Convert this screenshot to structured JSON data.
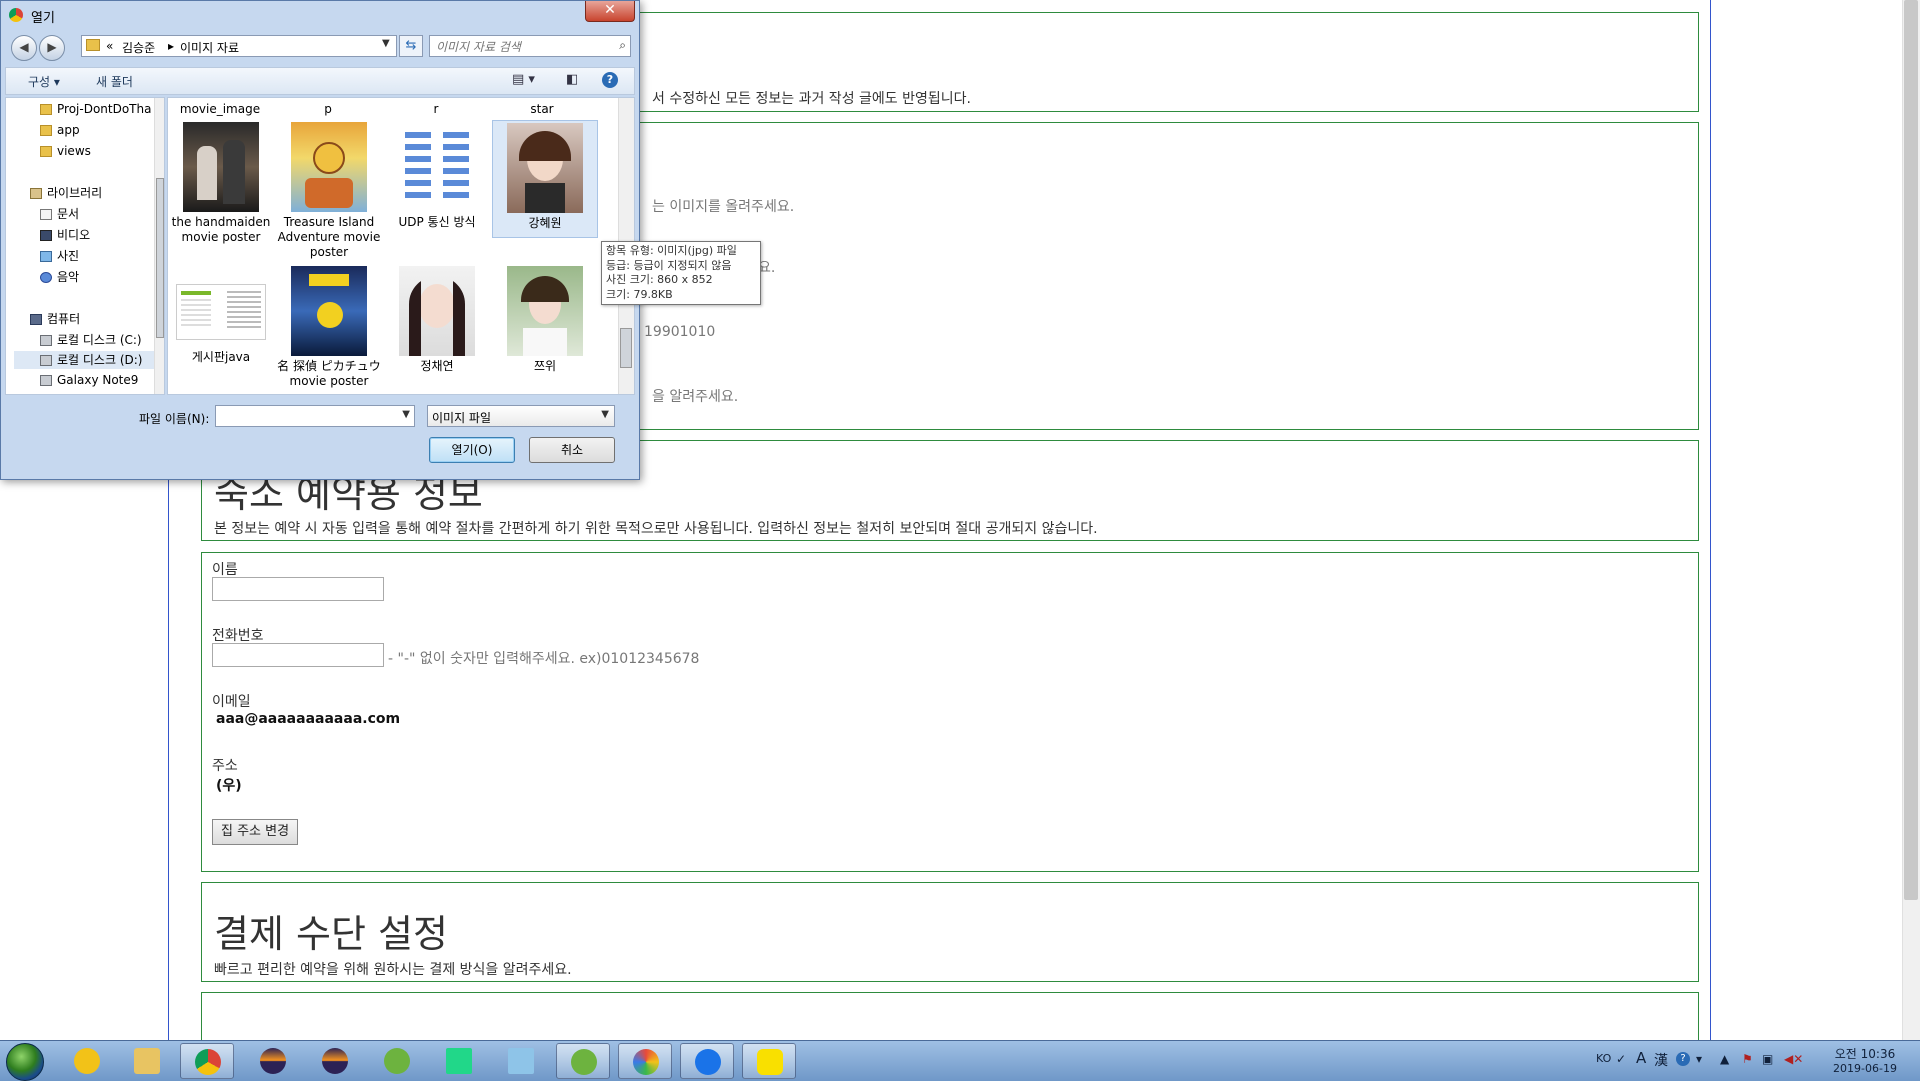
{
  "page": {
    "box1_desc": "서 수정하신 모든 정보는 과거 작성 글에도 반영됩니다.",
    "box2": {
      "hint1": "는 이미지를 올려주세요.",
      "hint2": "요.",
      "hint3": "19901010",
      "hint4": "을 알려주세요."
    },
    "lodging": {
      "title": "숙소 예약용 정보",
      "desc": "본 정보는 예약 시 자동 입력을 통해 예약 절차를 간편하게 하기 위한 목적으로만 사용됩니다. 입력하신 정보는 철저히 보안되며 절대 공개되지 않습니다."
    },
    "form": {
      "name_label": "이름",
      "phone_label": "전화번호",
      "phone_hint": "- \"-\" 없이 숫자만 입력해주세요. ex)01012345678",
      "email_label": "이메일",
      "email_value": "aaa@aaaaaaaaaaa.com",
      "address_label": "주소",
      "address_value": "(우)",
      "change_address_button": "집 주소 변경"
    },
    "payment": {
      "title": "결제 수단 설정",
      "desc": "빠르고 편리한 예약을 위해 원하시는 결제 방식을 알려주세요."
    }
  },
  "dialog": {
    "title": "열기",
    "close_label": "✕",
    "breadcrumb": [
      "«",
      "김승준",
      "▸",
      "이미지 자료"
    ],
    "search_placeholder": "이미지 자료 검색",
    "toolbar": {
      "organize": "구성 ▾",
      "new_folder": "새 폴더",
      "help": "?"
    },
    "nav_items": [
      {
        "label": "Proj-DontDoTha",
        "icon": "folder-icon"
      },
      {
        "label": "app",
        "icon": "folder-icon"
      },
      {
        "label": "views",
        "icon": "folder-icon"
      },
      {
        "label": "라이브러리",
        "icon": "library-icon"
      },
      {
        "label": "문서",
        "icon": "documents-icon"
      },
      {
        "label": "비디오",
        "icon": "video-icon"
      },
      {
        "label": "사진",
        "icon": "pictures-icon"
      },
      {
        "label": "음악",
        "icon": "music-icon"
      },
      {
        "label": "컴퓨터",
        "icon": "computer-icon"
      },
      {
        "label": "로컬 디스크 (C:)",
        "icon": "disk-icon"
      },
      {
        "label": "로컬 디스크 (D:)",
        "icon": "disk-icon"
      },
      {
        "label": "Galaxy Note9",
        "icon": "phone-icon"
      }
    ],
    "column_labels": [
      "movie_image",
      "p",
      "r",
      "star"
    ],
    "files": [
      {
        "label": "the handmaiden movie poster"
      },
      {
        "label": "Treasure Island Adventure movie poster"
      },
      {
        "label": "UDP 통신 방식"
      },
      {
        "label": "강혜원"
      },
      {
        "label": "게시판java"
      },
      {
        "label": "名 探偵 ピカチュウ movie poster"
      },
      {
        "label": "정채연"
      },
      {
        "label": "쯔위"
      }
    ],
    "tooltip": {
      "line1": "항목 유형: 이미지(jpg) 파일",
      "line2": "등급: 등급이 지정되지 않음",
      "line3": "사진 크기: 860 x 852",
      "line4": "크기: 79.8KB"
    },
    "filename_label": "파일 이름(N):",
    "filename_value": "",
    "filetype_value": "이미지 파일",
    "open_button": "열기(O)",
    "cancel_button": "취소"
  },
  "taskbar": {
    "apps": [
      "media-player",
      "file-explorer",
      "chrome",
      "eclipse",
      "eclipse-2",
      "spring-tool",
      "pycharm",
      "notepad",
      "spring-tool-2",
      "paint",
      "maps",
      "kakaotalk"
    ],
    "tray": {
      "lang": "KO",
      "ime_a": "A",
      "ime_han": "漢",
      "help": "?",
      "time": "오전 10:36",
      "date": "2019-06-19"
    }
  }
}
